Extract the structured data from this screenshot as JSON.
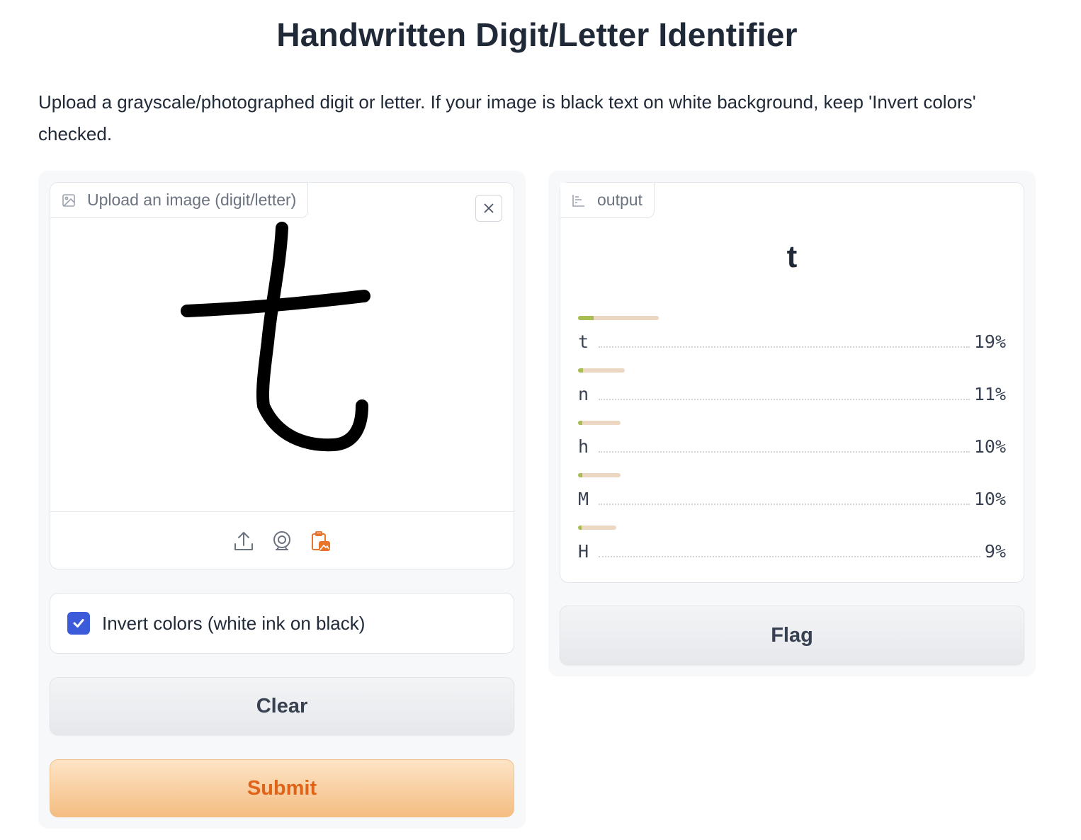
{
  "title": "Handwritten Digit/Letter Identifier",
  "description": "Upload a grayscale/photographed digit or letter. If your image is black text on white background, keep 'Invert colors' checked.",
  "image_input": {
    "label": "Upload an image (digit/letter)"
  },
  "invert": {
    "label": "Invert colors (white ink on black)",
    "checked": true
  },
  "buttons": {
    "clear": "Clear",
    "submit": "Submit",
    "flag": "Flag"
  },
  "output": {
    "label": "output",
    "prediction": "t",
    "confidences": [
      {
        "label": "t",
        "value": 0.19,
        "text": "19%"
      },
      {
        "label": "n",
        "value": 0.11,
        "text": "11%"
      },
      {
        "label": "h",
        "value": 0.1,
        "text": "10%"
      },
      {
        "label": "M",
        "value": 0.1,
        "text": "10%"
      },
      {
        "label": "H",
        "value": 0.09,
        "text": "9%"
      }
    ]
  },
  "colors": {
    "accent": "#e0631a",
    "checkbox": "#3b5bdb",
    "bar_fill": "#a7bd52",
    "bar_track": "#ecd8c2"
  }
}
